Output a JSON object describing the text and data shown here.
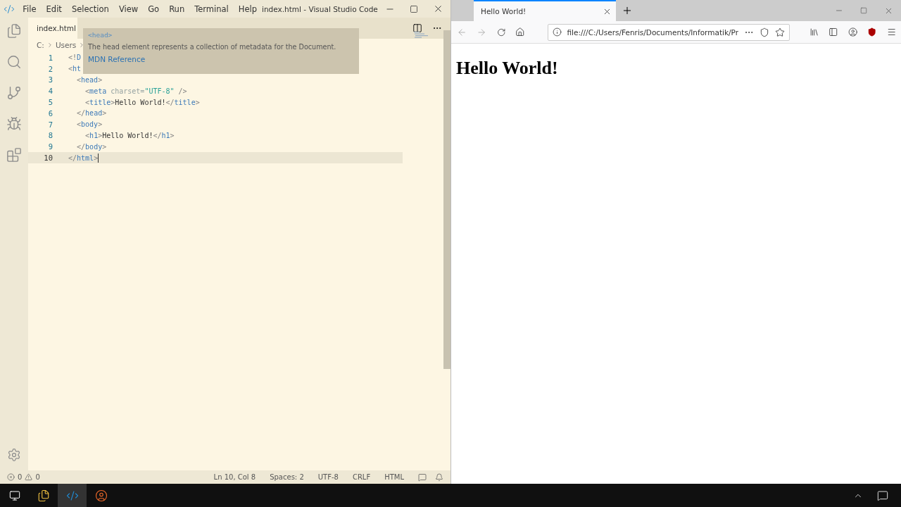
{
  "vscode": {
    "menu": [
      "File",
      "Edit",
      "Selection",
      "View",
      "Go",
      "Run",
      "Terminal",
      "Help"
    ],
    "title": "index.html - Visual Studio Code",
    "tab": {
      "label": "index.html",
      "selected": true
    },
    "breadcrumb": [
      "C:",
      "Users"
    ],
    "hover": {
      "tag": "<head>",
      "description": "The head element represents a collection of metadata for the Document.",
      "link": "MDN Reference"
    },
    "lines": [
      {
        "number": "1",
        "current": false,
        "tokens": [
          {
            "text": "<!",
            "kind": "punct"
          },
          {
            "text": "D",
            "kind": "tag"
          }
        ]
      },
      {
        "number": "2",
        "current": false,
        "tokens": [
          {
            "text": "<",
            "kind": "punct"
          },
          {
            "text": "ht",
            "kind": "tag"
          }
        ]
      },
      {
        "number": "3",
        "current": false,
        "tokens": [
          {
            "text": "  <",
            "kind": "punct"
          },
          {
            "text": "head",
            "kind": "tag"
          },
          {
            "text": ">",
            "kind": "punct"
          }
        ]
      },
      {
        "number": "4",
        "current": false,
        "tokens": [
          {
            "text": "    <",
            "kind": "punct"
          },
          {
            "text": "meta",
            "kind": "tag"
          },
          {
            "text": " charset=",
            "kind": "attr"
          },
          {
            "text": "\"UTF-8\"",
            "kind": "string"
          },
          {
            "text": " />",
            "kind": "punct"
          }
        ]
      },
      {
        "number": "5",
        "current": false,
        "tokens": [
          {
            "text": "    <",
            "kind": "punct"
          },
          {
            "text": "title",
            "kind": "tag"
          },
          {
            "text": ">",
            "kind": "punct"
          },
          {
            "text": "Hello World!",
            "kind": "text"
          },
          {
            "text": "</",
            "kind": "punct"
          },
          {
            "text": "title",
            "kind": "tag"
          },
          {
            "text": ">",
            "kind": "punct"
          }
        ]
      },
      {
        "number": "6",
        "current": false,
        "tokens": [
          {
            "text": "  </",
            "kind": "punct"
          },
          {
            "text": "head",
            "kind": "tag"
          },
          {
            "text": ">",
            "kind": "punct"
          }
        ]
      },
      {
        "number": "7",
        "current": false,
        "tokens": [
          {
            "text": "  <",
            "kind": "punct"
          },
          {
            "text": "body",
            "kind": "tag"
          },
          {
            "text": ">",
            "kind": "punct"
          }
        ]
      },
      {
        "number": "8",
        "current": false,
        "tokens": [
          {
            "text": "    <",
            "kind": "punct"
          },
          {
            "text": "h1",
            "kind": "tag"
          },
          {
            "text": ">",
            "kind": "punct"
          },
          {
            "text": "Hello World!",
            "kind": "text"
          },
          {
            "text": "</",
            "kind": "punct"
          },
          {
            "text": "h1",
            "kind": "tag"
          },
          {
            "text": ">",
            "kind": "punct"
          }
        ]
      },
      {
        "number": "9",
        "current": false,
        "tokens": [
          {
            "text": "  </",
            "kind": "punct"
          },
          {
            "text": "body",
            "kind": "tag"
          },
          {
            "text": ">",
            "kind": "punct"
          }
        ]
      },
      {
        "number": "10",
        "current": true,
        "tokens": [
          {
            "text": "</",
            "kind": "punct"
          },
          {
            "text": "html",
            "kind": "tag"
          },
          {
            "text": ">",
            "kind": "punct"
          }
        ]
      }
    ],
    "status": {
      "errors": "0",
      "warnings": "0",
      "items": [
        "Ln 10, Col 8",
        "Spaces: 2",
        "UTF-8",
        "CRLF",
        "HTML"
      ]
    }
  },
  "browser": {
    "tab": {
      "label": "Hello World!",
      "selected": true
    },
    "url": "file:///C:/Users/Fenris/Documents/Informatik/Pr",
    "heading": "Hello World!"
  }
}
